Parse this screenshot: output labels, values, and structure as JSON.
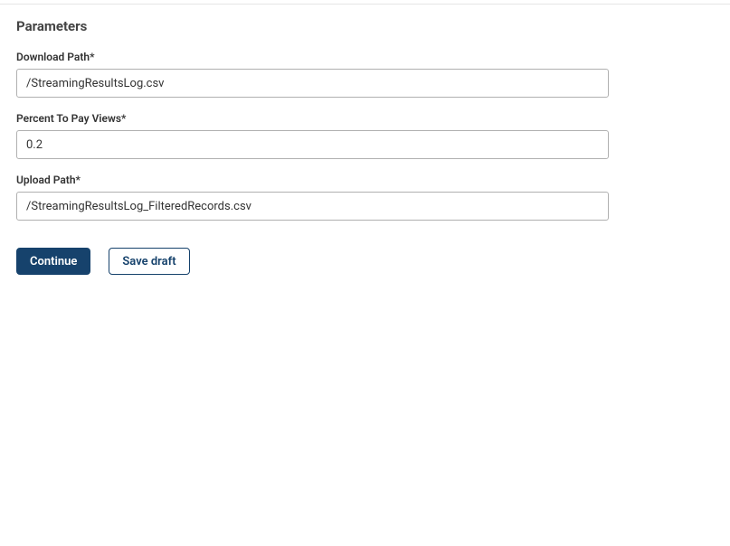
{
  "section": {
    "title": "Parameters"
  },
  "fields": {
    "download_path": {
      "label": "Download Path*",
      "value": "/StreamingResultsLog.csv"
    },
    "percent_to_pay_views": {
      "label": "Percent To Pay Views*",
      "value": "0.2"
    },
    "upload_path": {
      "label": "Upload Path*",
      "value": "/StreamingResultsLog_FilteredRecords.csv"
    }
  },
  "buttons": {
    "continue": "Continue",
    "save_draft": "Save draft"
  }
}
